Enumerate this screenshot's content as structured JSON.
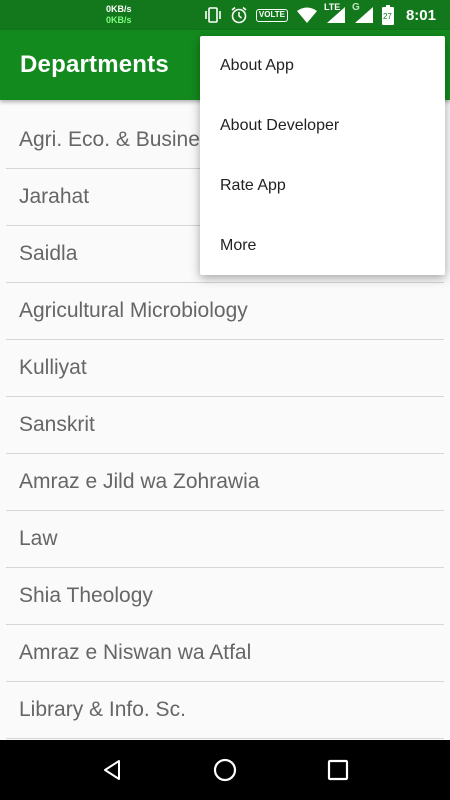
{
  "status_bar": {
    "net_up": "0KB/s",
    "net_down": "0KB/s",
    "volte": "VOLTE",
    "lte": "LTE",
    "g": "G",
    "battery": "27",
    "time": "8:01",
    "icons": [
      "vibrate-icon",
      "alarm-icon",
      "wifi-icon",
      "signal-icon",
      "battery-icon"
    ]
  },
  "app_bar": {
    "title": "Departments",
    "color": "#138a1e"
  },
  "departments": [
    "Agri. Eco. & Business Management",
    "Jarahat",
    "Saidla",
    "Agricultural Microbiology",
    "Kulliyat",
    "Sanskrit",
    "Amraz e Jild wa Zohrawia",
    "Law",
    "Shia Theology",
    "Amraz e Niswan wa Atfal",
    "Library & Info. Sc."
  ],
  "menu": {
    "items": [
      "About App",
      "About Developer",
      "Rate App",
      "More"
    ]
  },
  "nav_bar": {
    "icons": [
      "back-icon",
      "home-icon",
      "recents-icon"
    ]
  }
}
